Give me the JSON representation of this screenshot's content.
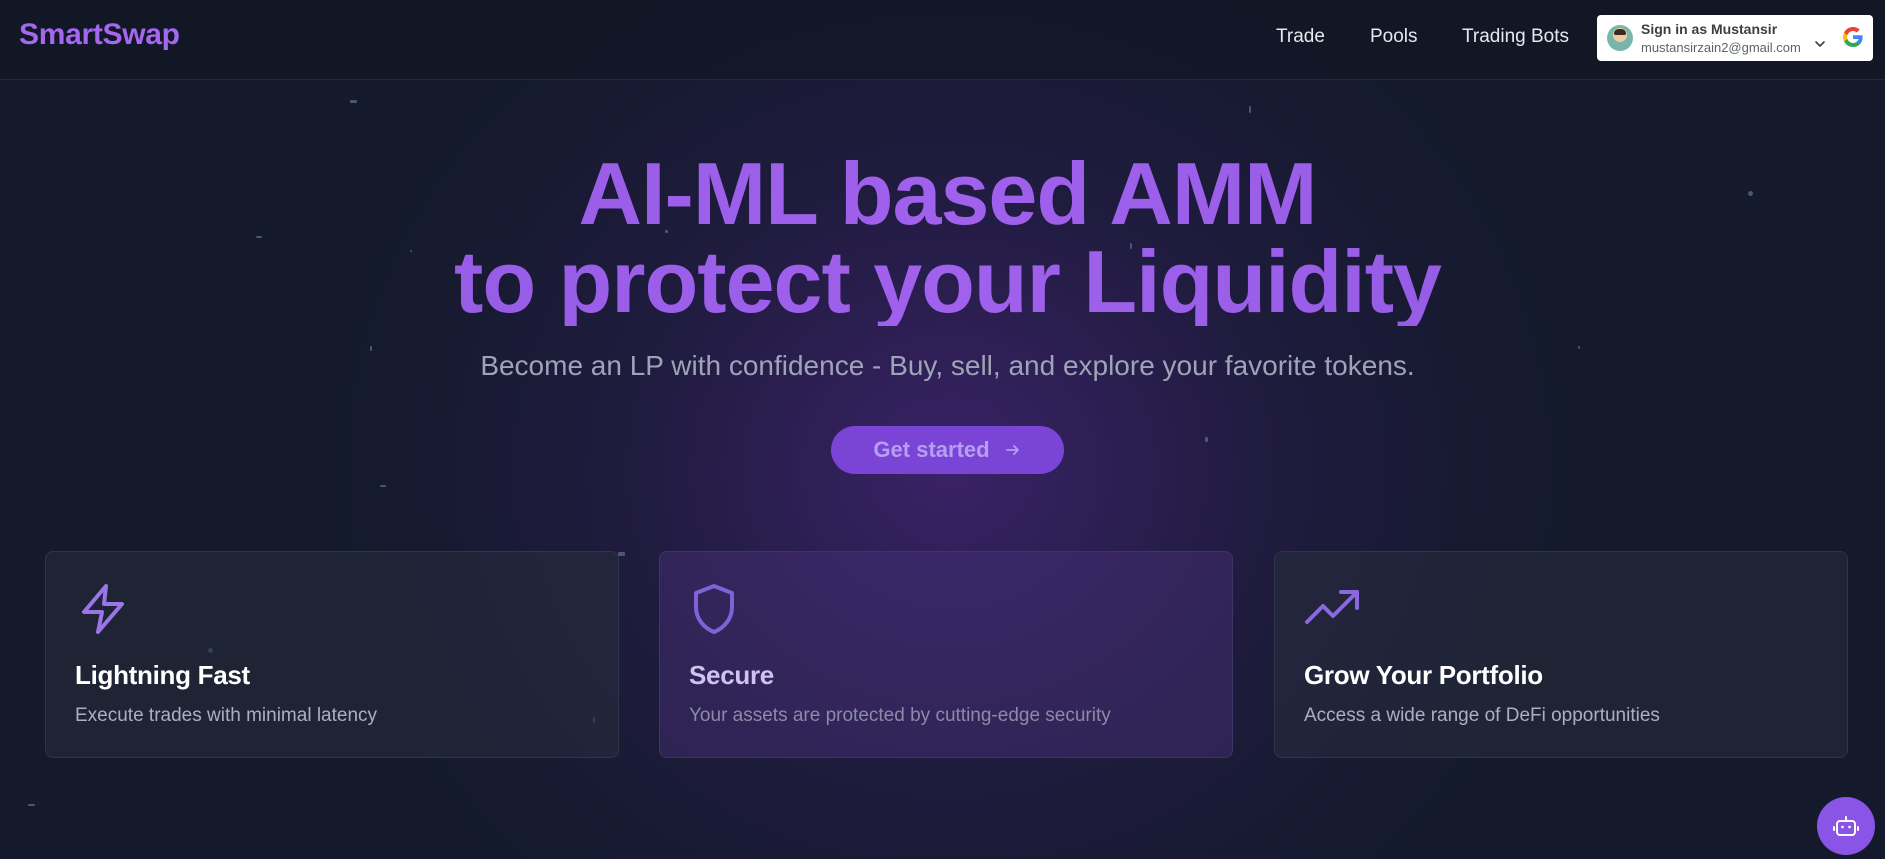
{
  "header": {
    "logo": "SmartSwap",
    "nav": [
      "Trade",
      "Pools",
      "Trading Bots"
    ],
    "signin": {
      "name": "Sign in as Mustansir",
      "email": "mustansirzain2@gmail.com"
    }
  },
  "hero": {
    "title_line1": "AI-ML based AMM",
    "title_line2": "to protect your Liquidity",
    "subtitle": "Become an LP with confidence - Buy, sell, and explore your favorite tokens.",
    "cta_label": "Get started"
  },
  "features": [
    {
      "icon": "lightning-icon",
      "title": "Lightning Fast",
      "desc": "Execute trades with minimal latency"
    },
    {
      "icon": "shield-icon",
      "title": "Secure",
      "desc": "Your assets are protected by cutting-edge security"
    },
    {
      "icon": "trending-up-icon",
      "title": "Grow Your Portfolio",
      "desc": "Access a wide range of DeFi opportunities"
    }
  ],
  "colors": {
    "accent": "#a468f0",
    "background": "#141a2c",
    "cta": "#7a45d6"
  }
}
